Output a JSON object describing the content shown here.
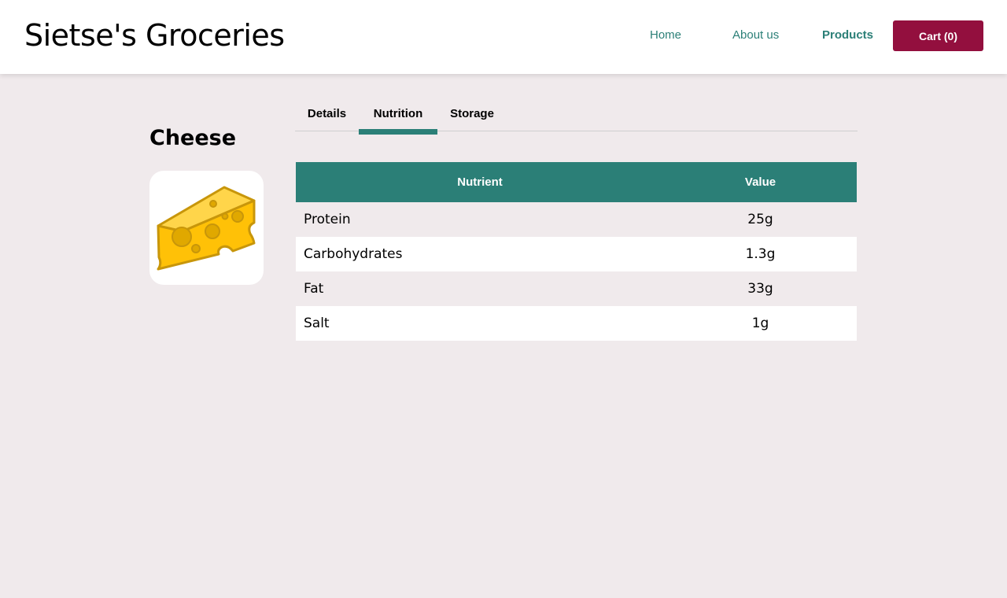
{
  "header": {
    "brand": "Sietse's Groceries",
    "nav": {
      "home": "Home",
      "about": "About us",
      "products": "Products"
    },
    "cart_label": "Cart (0)"
  },
  "product": {
    "title": "Cheese",
    "image_icon": "cheese-icon"
  },
  "tabs": [
    {
      "label": "Details",
      "active": false
    },
    {
      "label": "Nutrition",
      "active": true
    },
    {
      "label": "Storage",
      "active": false
    }
  ],
  "nutrition_table": {
    "columns": [
      "Nutrient",
      "Value"
    ],
    "rows": [
      {
        "nutrient": "Protein",
        "value": "25g"
      },
      {
        "nutrient": "Carbohydrates",
        "value": "1.3g"
      },
      {
        "nutrient": "Fat",
        "value": "33g"
      },
      {
        "nutrient": "Salt",
        "value": "1g"
      }
    ]
  },
  "colors": {
    "accent_teal": "#2b7f77",
    "cart_button": "#930f3e",
    "page_background": "#f0eaec",
    "cheese_fill": "#ffc107",
    "cheese_outline": "#c8960a"
  }
}
